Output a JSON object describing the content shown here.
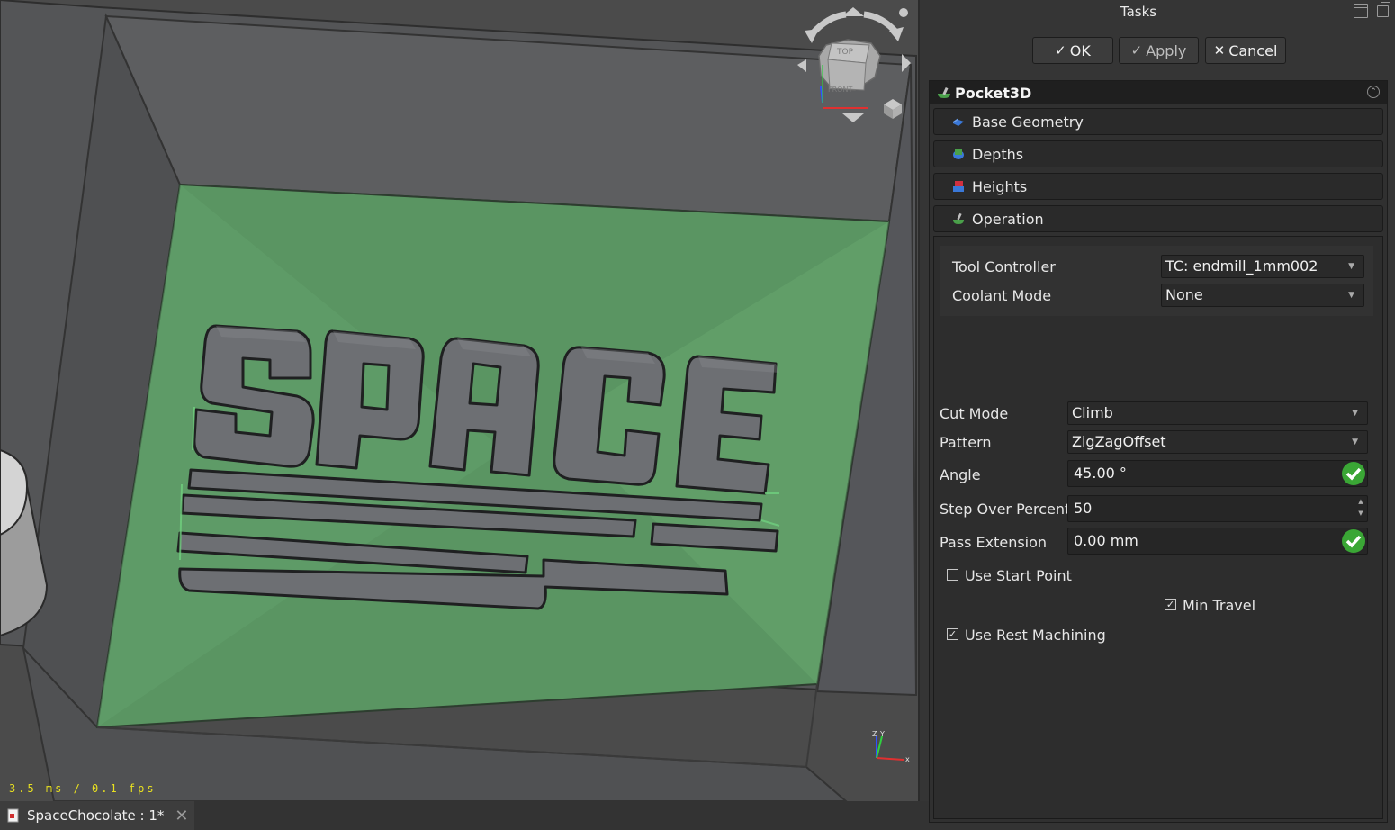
{
  "viewport": {
    "fps_text": "3.5 ms / 0.1 fps",
    "navcube": {
      "top_label": "TOP",
      "front_label": "FRONT"
    },
    "axis": {
      "x": "x",
      "y": "Y",
      "z": "Z"
    },
    "colors": {
      "background": "#4a4a4a",
      "stock_floor": "#5c9a66",
      "model": "#6e7074"
    }
  },
  "document_tab": {
    "title": "SpaceChocolate : 1*"
  },
  "tasks": {
    "title": "Tasks",
    "buttons": {
      "ok": "OK",
      "apply": "Apply",
      "cancel": "Cancel"
    },
    "panel_title": "Pocket3D",
    "sections": {
      "base_geometry": "Base Geometry",
      "depths": "Depths",
      "heights": "Heights",
      "operation": "Operation"
    },
    "operation": {
      "tool_controller": {
        "label": "Tool Controller",
        "value": "TC: endmill_1mm002"
      },
      "coolant_mode": {
        "label": "Coolant Mode",
        "value": "None"
      },
      "cut_mode": {
        "label": "Cut Mode",
        "value": "Climb"
      },
      "pattern": {
        "label": "Pattern",
        "value": "ZigZagOffset"
      },
      "angle": {
        "label": "Angle",
        "value": "45.00 °"
      },
      "step_over": {
        "label": "Step Over Percent",
        "value": "50"
      },
      "pass_extension": {
        "label": "Pass Extension",
        "value": "0.00 mm"
      },
      "use_start_point": {
        "label": "Use Start Point",
        "checked": false
      },
      "min_travel": {
        "label": "Min Travel",
        "checked": true
      },
      "use_rest_machining": {
        "label": "Use Rest Machining",
        "checked": true
      }
    },
    "accent": "#3aa635"
  }
}
